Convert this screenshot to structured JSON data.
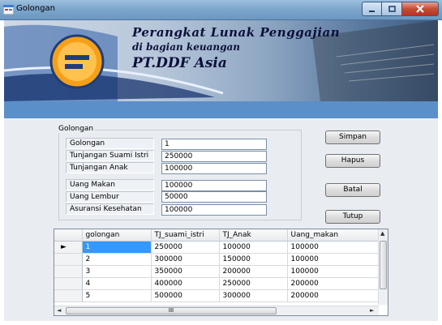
{
  "window": {
    "title": "Golongan"
  },
  "banner": {
    "line1": "Perangkat Lunak Penggajian",
    "line2": "di bagian keuangan",
    "line3": "PT.DDF Asia"
  },
  "form": {
    "group_title": "Golongan",
    "fields": [
      {
        "label": "Golongan",
        "value": "1"
      },
      {
        "label": "Tunjangan Suami Istri",
        "value": "250000"
      },
      {
        "label": "Tunjangan Anak",
        "value": "100000"
      },
      {
        "label": "Uang Makan",
        "value": "100000"
      },
      {
        "label": "Uang Lembur",
        "value": "50000"
      },
      {
        "label": "Asuransi Kesehatan",
        "value": "100000"
      }
    ]
  },
  "buttons": {
    "simpan": "Simpan",
    "hapus": "Hapus",
    "batal": "Batal",
    "tutup": "Tutup"
  },
  "grid": {
    "columns": [
      "golongan",
      "TJ_suami_istri",
      "TJ_Anak",
      "Uang_makan"
    ],
    "rows": [
      [
        "1",
        "250000",
        "100000",
        "100000"
      ],
      [
        "2",
        "300000",
        "150000",
        "100000"
      ],
      [
        "3",
        "350000",
        "200000",
        "100000"
      ],
      [
        "4",
        "400000",
        "250000",
        "200000"
      ],
      [
        "5",
        "500000",
        "300000",
        "200000"
      ]
    ],
    "selected_row_marker": "►",
    "hscroll_grip": "III"
  },
  "colors": {
    "selection": "#3399ff",
    "strip": "#5a8fc9",
    "close_button": "#c64b36"
  }
}
